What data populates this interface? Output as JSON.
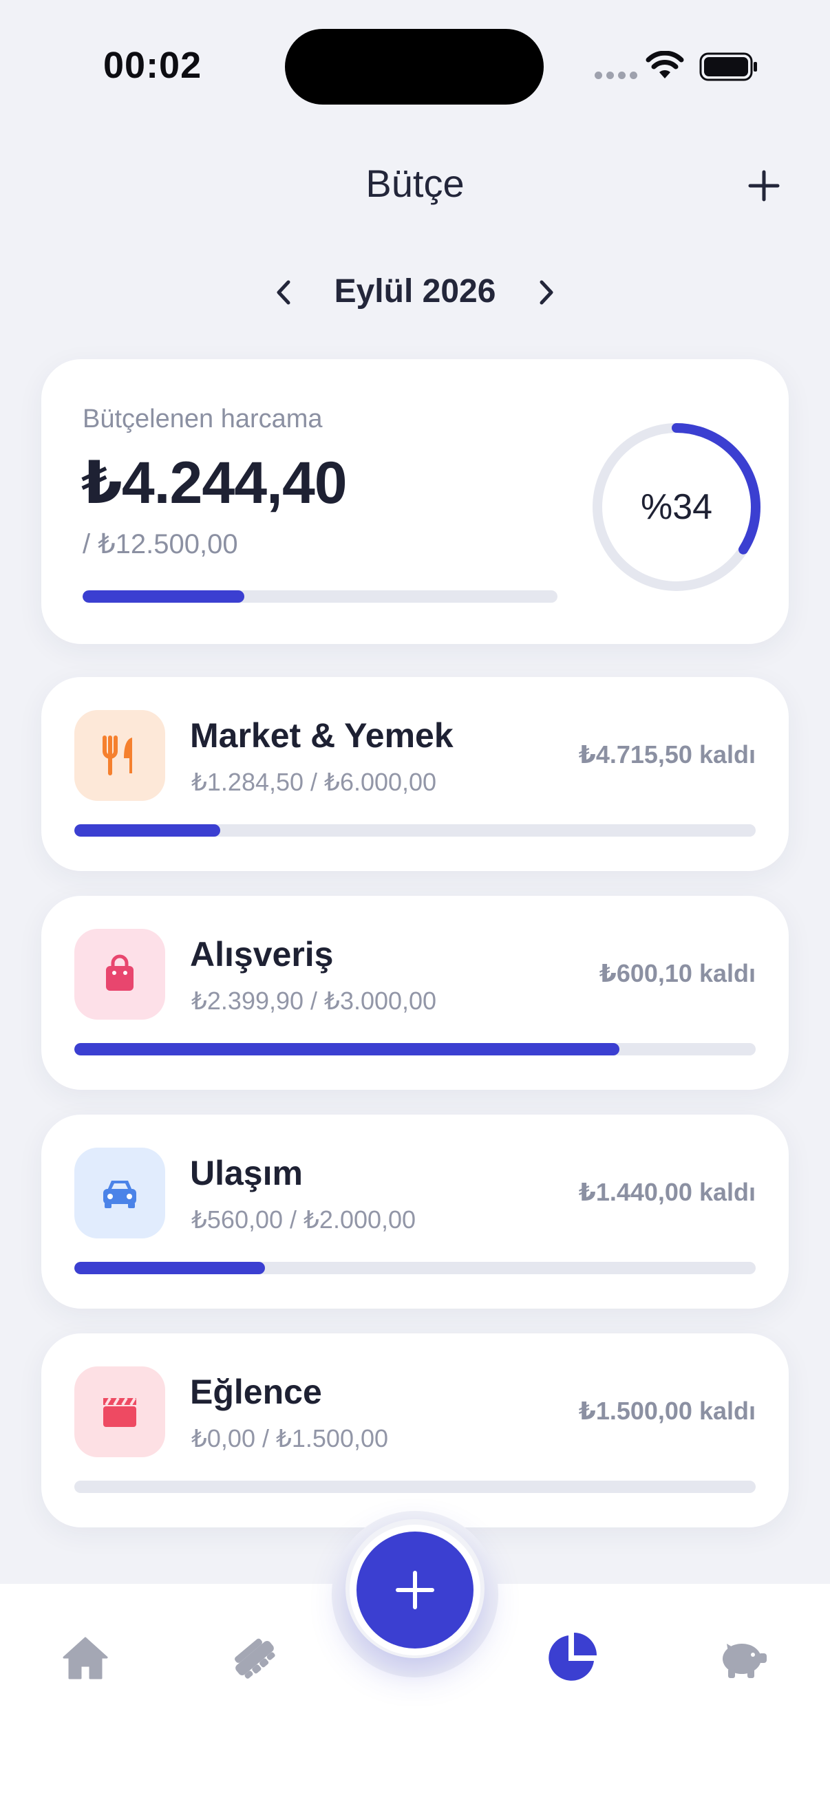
{
  "status_bar": {
    "time": "00:02"
  },
  "header": {
    "title": "Bütçe"
  },
  "month_nav": {
    "label": "Eylül 2026"
  },
  "summary": {
    "label": "Bütçelenen harcama",
    "amount": "₺4.244,40",
    "total": "/ ₺12.500,00",
    "percent_label": "%34",
    "progress": 0.34
  },
  "categories": [
    {
      "name": "Market & Yemek",
      "amounts": "₺1.284,50 / ₺6.000,00",
      "remaining": "₺4.715,50 kaldı",
      "progress": 0.214,
      "icon": "utensils-icon",
      "icon_color": "#f5802e",
      "icon_bg": "#fde8d8"
    },
    {
      "name": "Alışveriş",
      "amounts": "₺2.399,90 / ₺3.000,00",
      "remaining": "₺600,10 kaldı",
      "progress": 0.8,
      "icon": "shopping-bag-icon",
      "icon_color": "#e8466e",
      "icon_bg": "#fde0e8"
    },
    {
      "name": "Ulaşım",
      "amounts": "₺560,00 / ₺2.000,00",
      "remaining": "₺1.440,00 kaldı",
      "progress": 0.28,
      "icon": "car-icon",
      "icon_color": "#4b83e8",
      "icon_bg": "#e1ecfd"
    },
    {
      "name": "Eğlence",
      "amounts": "₺0,00 / ₺1.500,00",
      "remaining": "₺1.500,00 kaldı",
      "progress": 0.0,
      "icon": "clapperboard-icon",
      "icon_color": "#ee4a62",
      "icon_bg": "#fde0e4"
    }
  ],
  "tab_bar": {
    "items": [
      {
        "icon": "home-icon",
        "active": false
      },
      {
        "icon": "handshake-icon",
        "active": false
      },
      {
        "icon": "pie-chart-icon",
        "active": true
      },
      {
        "icon": "piggy-bank-icon",
        "active": false
      }
    ]
  },
  "colors": {
    "accent": "#3b3fd1",
    "track": "#e5e7ef",
    "inactive_icon": "#a4a7b4"
  }
}
